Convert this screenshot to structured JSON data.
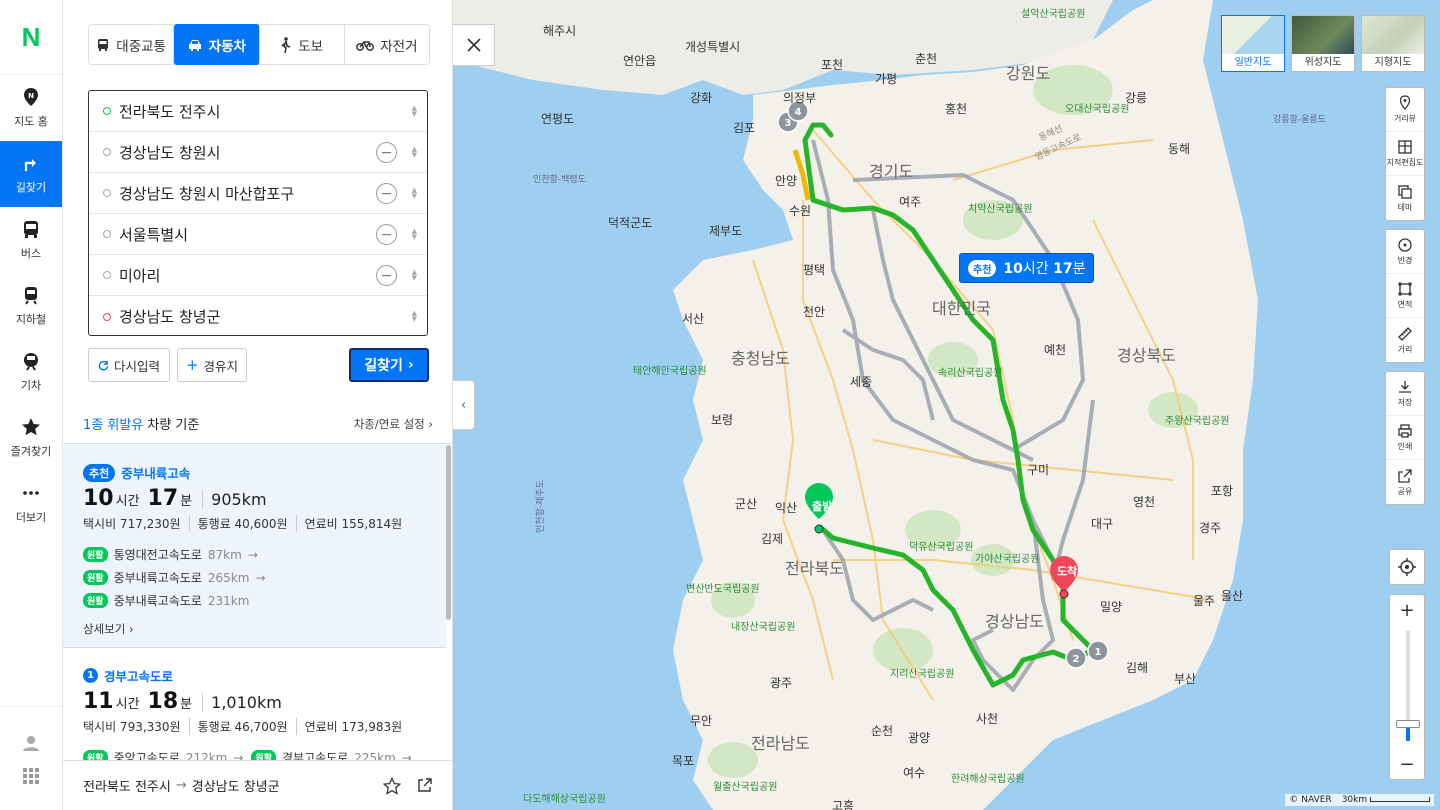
{
  "app": {
    "logo": "N"
  },
  "rail": {
    "items": [
      {
        "label": "지도 홈",
        "icon": "map-pin-icon"
      },
      {
        "label": "길찾기",
        "icon": "directions-icon",
        "active": true
      },
      {
        "label": "버스",
        "icon": "bus-icon"
      },
      {
        "label": "지하철",
        "icon": "subway-icon"
      },
      {
        "label": "기차",
        "icon": "train-icon"
      },
      {
        "label": "즐겨찾기",
        "icon": "star-icon"
      },
      {
        "label": "더보기",
        "icon": "more-icon"
      }
    ]
  },
  "modes": [
    {
      "label": "대중교통",
      "icon": "bus-icon"
    },
    {
      "label": "자동차",
      "icon": "car-icon",
      "active": true
    },
    {
      "label": "도보",
      "icon": "walk-icon"
    },
    {
      "label": "자전거",
      "icon": "bike-icon"
    }
  ],
  "waypoints": [
    {
      "value": "전라북도 전주시",
      "type": "start"
    },
    {
      "value": "경상남도 창원시",
      "type": "via"
    },
    {
      "value": "경상남도 창원시 마산합포구",
      "type": "via"
    },
    {
      "value": "서울특별시",
      "type": "via"
    },
    {
      "value": "미아리",
      "type": "via"
    },
    {
      "value": "경상남도 창녕군",
      "type": "end"
    }
  ],
  "buttons": {
    "reset": "다시입력",
    "add_waypoint": "경유지",
    "search": "길찾기"
  },
  "fuel": {
    "highlight": "1종 휘발유",
    "rest": " 차량 기준",
    "settings": "차종/연료 설정"
  },
  "routes": [
    {
      "tag": "추천",
      "name": "중부내륙고속",
      "hours": "10",
      "hours_unit": "시간",
      "minutes": "17",
      "minutes_unit": "분",
      "distance": "905km",
      "taxi": "택시비 717,230원",
      "toll": "통행료 40,600원",
      "fuel": "연료비 155,814원",
      "segments": [
        {
          "pill": "원활",
          "road": "통영대전고속도로",
          "km": "87km"
        },
        {
          "pill": "원활",
          "road": "중부내륙고속도로",
          "km": "265km"
        },
        {
          "pill": "원활",
          "road": "중부내륙고속도로",
          "km": "231km"
        }
      ],
      "detail": "상세보기"
    },
    {
      "tag": "1",
      "name": "경부고속도로",
      "hours": "11",
      "hours_unit": "시간",
      "minutes": "18",
      "minutes_unit": "분",
      "distance": "1,010km",
      "taxi": "택시비 793,330원",
      "toll": "통행료 46,700원",
      "fuel": "연료비 173,983원",
      "segments": [
        {
          "pill": "원활",
          "road": "중앙고속도로",
          "km": "212km"
        },
        {
          "pill": "원활",
          "road": "경부고속도로",
          "km": "225km"
        }
      ]
    }
  ],
  "footer": {
    "from": "전라북도 전주시",
    "to": "경상남도 창녕군"
  },
  "map": {
    "badge_tag": "추천",
    "badge_hours": "10",
    "badge_hours_unit": "시간",
    "badge_minutes": "17",
    "badge_minutes_unit": "분",
    "start_marker": "출발",
    "end_marker": "도착",
    "map_types": [
      "일반지도",
      "위성지도",
      "지형지도"
    ],
    "tools1": [
      "거리뷰",
      "지적편집도",
      "테마"
    ],
    "tools2": [
      "반경",
      "면적",
      "거리"
    ],
    "tools3": [
      "저장",
      "인쇄",
      "공유"
    ],
    "credit": "© NAVER",
    "scale": "30km",
    "place_labels": [
      "해주시",
      "개성특별시",
      "연안읍",
      "강화",
      "김포",
      "의정부",
      "포천",
      "가평",
      "춘천",
      "강원도",
      "홍천",
      "강릉",
      "동해",
      "연평도",
      "안양",
      "수원",
      "여주",
      "경기도",
      "덕적군도",
      "제부도",
      "평택",
      "대한민국",
      "천안",
      "서산",
      "충청남도",
      "태안해안국립공원",
      "세종",
      "보령",
      "예천",
      "경상북도",
      "주왕산국립공원",
      "구미",
      "군산",
      "익산",
      "김제",
      "대구",
      "영천",
      "포항",
      "경주",
      "전라북도",
      "울산",
      "부산",
      "김해",
      "경상남도",
      "밀양",
      "광주",
      "전라남도",
      "무안",
      "목포",
      "순천",
      "여수",
      "사천",
      "광양",
      "고흥",
      "월출산국립공원",
      "내장산국립공원",
      "변산반도국립공원",
      "지리산국립공원",
      "덕유산국립공원",
      "가야산국립공원",
      "속리산국립공원",
      "치악산국립공원",
      "오대산국립공원",
      "설악산국립공원",
      "한려해상국립공원",
      "다도해해상국립공원",
      "울주",
      "동해선",
      "영동고속도로",
      "강릉항-울릉도",
      "인천항-백령도",
      "인천항-제주도"
    ],
    "route_labels": [
      "1",
      "2",
      "3",
      "4"
    ]
  },
  "colors": {
    "accent": "#0475f4",
    "route": "#27b42a",
    "alt_route": "#9aa3ad",
    "start": "#03c75a",
    "end": "#f0485a"
  }
}
